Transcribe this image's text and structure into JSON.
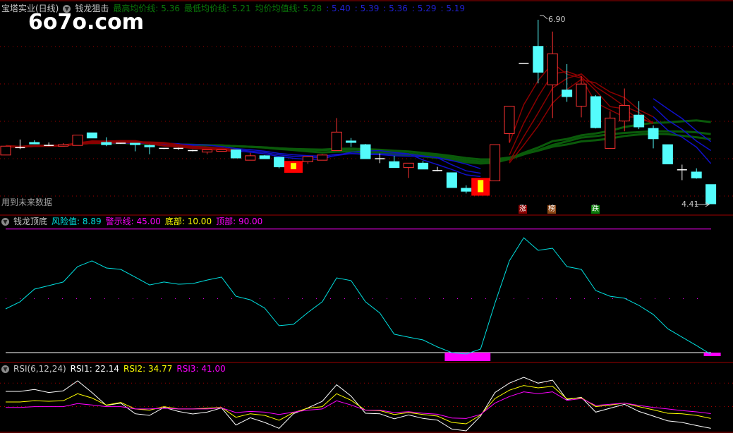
{
  "header": {
    "stock": "宝塔实业(日线)",
    "indicator": "钱龙狙击",
    "ma_high_label": "最高均价线:",
    "ma_high_value": "5.36",
    "ma_low_label": "最低均价线:",
    "ma_low_value": "5.21",
    "ma_avg_label": "均价均值线:",
    "ma_avg_value": "5.28",
    "blue_values": [
      ": 5.40",
      ": 5.39",
      ": 5.36",
      ": 5.29",
      ": 5.19"
    ]
  },
  "logo": "6o7o.com",
  "note": "用到未来数据",
  "markers": [
    "涨",
    "榜",
    "跌"
  ],
  "annotations": {
    "high": "6.90",
    "low": "4.41"
  },
  "panel2": {
    "title": "钱龙顶底",
    "risk_label": "风险值:",
    "risk_value": "8.89",
    "warn_label": "警示线:",
    "warn_value": "45.00",
    "bottom_label": "底部:",
    "bottom_value": "10.00",
    "top_label": "顶部:",
    "top_value": "90.00"
  },
  "panel3": {
    "title": "RSI(6,12,24)",
    "rsi1_label": "RSI1:",
    "rsi1_value": "22.14",
    "rsi2_label": "RSI2:",
    "rsi2_value": "34.77",
    "rsi3_label": "RSI3:",
    "rsi3_value": "41.00"
  },
  "colors": {
    "up": "#ff3232",
    "down": "#54fcfc",
    "grid": "#a00000",
    "green": "#0a5a0a",
    "blue": "#1010c8",
    "darkred": "#8b0000",
    "magenta": "#ff00ff",
    "yellow": "#ffff00",
    "cyan": "#00e0e0"
  },
  "chart_data": [
    {
      "type": "candlestick",
      "title": "宝塔实业(日线)",
      "price_range": [
        4.41,
        6.9
      ],
      "ohlc": [
        [
          5.07,
          5.19,
          5.07,
          5.19
        ],
        [
          5.16,
          5.28,
          5.15,
          5.17
        ],
        [
          5.24,
          5.27,
          5.22,
          5.22
        ],
        [
          5.19,
          5.24,
          5.19,
          5.2
        ],
        [
          5.19,
          5.23,
          5.19,
          5.21
        ],
        [
          5.2,
          5.34,
          5.2,
          5.34
        ],
        [
          5.37,
          5.37,
          5.3,
          5.3
        ],
        [
          5.24,
          5.31,
          5.19,
          5.21
        ],
        [
          5.22,
          5.23,
          5.22,
          5.23
        ],
        [
          5.23,
          5.23,
          5.12,
          5.21
        ],
        [
          5.2,
          5.21,
          5.08,
          5.18
        ],
        [
          5.15,
          5.16,
          5.15,
          5.16
        ],
        [
          5.16,
          5.17,
          5.14,
          5.15
        ],
        [
          5.12,
          5.14,
          5.12,
          5.13
        ],
        [
          5.11,
          5.14,
          5.08,
          5.14
        ],
        [
          5.12,
          5.14,
          5.12,
          5.14
        ],
        [
          5.14,
          5.14,
          5.03,
          5.03
        ],
        [
          5.0,
          5.1,
          5.0,
          5.06
        ],
        [
          5.06,
          5.07,
          5.02,
          5.02
        ],
        [
          5.04,
          5.04,
          4.89,
          4.91
        ],
        [
          4.83,
          4.99,
          4.83,
          4.99
        ],
        [
          4.98,
          5.05,
          4.95,
          5.05
        ],
        [
          5.0,
          5.08,
          5.0,
          5.07
        ],
        [
          5.13,
          5.57,
          5.13,
          5.38
        ],
        [
          5.26,
          5.3,
          5.18,
          5.24
        ],
        [
          5.21,
          5.22,
          5.02,
          5.02
        ],
        [
          5.02,
          5.09,
          4.96,
          5.02
        ],
        [
          4.98,
          5.06,
          4.9,
          4.9
        ],
        [
          4.9,
          4.96,
          4.76,
          4.96
        ],
        [
          4.96,
          4.99,
          4.88,
          4.88
        ],
        [
          4.85,
          4.91,
          4.85,
          4.86
        ],
        [
          4.83,
          4.83,
          4.63,
          4.63
        ],
        [
          4.62,
          4.66,
          4.55,
          4.58
        ],
        [
          4.52,
          4.76,
          4.52,
          4.76
        ],
        [
          4.72,
          5.21,
          4.72,
          5.21
        ],
        [
          5.36,
          5.73,
          5.24,
          5.73
        ],
        [
          6.31,
          6.31,
          6.31,
          6.31
        ],
        [
          6.54,
          6.9,
          6.04,
          6.19
        ],
        [
          6.02,
          6.74,
          5.57,
          6.44
        ],
        [
          5.95,
          6.3,
          5.79,
          5.86
        ],
        [
          5.73,
          6.14,
          5.58,
          6.03
        ],
        [
          5.86,
          5.88,
          5.43,
          5.44
        ],
        [
          5.16,
          5.66,
          5.16,
          5.57
        ],
        [
          5.53,
          5.97,
          5.39,
          5.74
        ],
        [
          5.61,
          5.8,
          5.42,
          5.45
        ],
        [
          5.43,
          5.47,
          5.16,
          5.29
        ],
        [
          5.21,
          5.21,
          4.95,
          4.95
        ],
        [
          4.87,
          4.94,
          4.73,
          4.87
        ],
        [
          4.84,
          4.89,
          4.75,
          4.76
        ],
        [
          4.67,
          4.67,
          4.41,
          4.41
        ]
      ],
      "limit_up_days": [
        20,
        33
      ]
    },
    {
      "type": "line",
      "title": "钱龙顶底",
      "ylim": [
        10,
        90
      ],
      "reference_lines": {
        "top": 90,
        "warn": 45,
        "bottom": 10
      },
      "risk": [
        38.3,
        42.9,
        51.1,
        53.4,
        55.7,
        65.7,
        69.4,
        64.8,
        63.9,
        58.9,
        53.8,
        55.7,
        54.3,
        54.7,
        57.0,
        58.9,
        46.5,
        44.2,
        38.8,
        27.4,
        28.3,
        36.0,
        42.9,
        58.4,
        56.6,
        42.9,
        35.6,
        21.9,
        20.0,
        18.2,
        13.7,
        10.0,
        9.1,
        12.3,
        42.0,
        69.4,
        84.4,
        76.2,
        77.6,
        65.7,
        63.9,
        50.2,
        46.5,
        45.2,
        40.6,
        34.7,
        25.5,
        20.0,
        14.6,
        8.89
      ],
      "bottom_signal_days": [
        31,
        32,
        33,
        49
      ]
    },
    {
      "type": "line",
      "title": "RSI(6,12,24)",
      "ylim": [
        0,
        100
      ],
      "reference_lines": [
        80,
        50
      ],
      "series": [
        {
          "name": "RSI1",
          "values": [
            69.4,
            69.4,
            71.8,
            67.9,
            70.0,
            82.9,
            67.9,
            51.4,
            54.4,
            40.8,
            38.7,
            48.9,
            43.8,
            40.5,
            42.9,
            48.3,
            26.4,
            35.7,
            29.7,
            22.2,
            40.8,
            48.3,
            56.7,
            77.8,
            63.4,
            41.4,
            40.8,
            34.3,
            39.3,
            34.9,
            32.7,
            21.3,
            18.9,
            37.8,
            67.9,
            79.9,
            87.4,
            79.9,
            83.8,
            58.9,
            61.9,
            42.9,
            47.8,
            52.9,
            43.8,
            37.8,
            31.8,
            29.7,
            25.8,
            22.14
          ]
        },
        {
          "name": "RSI2",
          "values": [
            55.9,
            55.9,
            57.4,
            56.8,
            57.4,
            66.4,
            60.9,
            51.9,
            55.2,
            46.9,
            45.4,
            49.9,
            46.9,
            46.9,
            47.8,
            48.9,
            36.3,
            40.8,
            38.7,
            32.4,
            42.3,
            47.8,
            49.9,
            66.4,
            58.0,
            45.4,
            44.8,
            39.9,
            42.3,
            39.9,
            37.8,
            29.7,
            27.9,
            39.3,
            60.3,
            70.9,
            76.9,
            73.9,
            75.9,
            59.8,
            61.3,
            49.9,
            51.9,
            54.4,
            49.9,
            45.9,
            41.4,
            40.8,
            38.7,
            34.77
          ]
        },
        {
          "name": "RSI3",
          "values": [
            48.9,
            48.9,
            49.9,
            49.9,
            49.9,
            53.8,
            52.0,
            49.9,
            49.9,
            46.9,
            46.9,
            47.8,
            46.9,
            46.9,
            46.9,
            48.3,
            42.3,
            43.8,
            42.9,
            39.9,
            42.9,
            45.4,
            46.9,
            57.4,
            52.0,
            45.4,
            45.4,
            42.3,
            43.5,
            41.4,
            40.2,
            35.4,
            34.8,
            39.9,
            54.4,
            62.8,
            68.8,
            66.4,
            68.8,
            57.9,
            60.3,
            51.4,
            52.9,
            54.4,
            51.4,
            48.9,
            46.9,
            44.8,
            43.2,
            41.0
          ]
        }
      ]
    }
  ]
}
